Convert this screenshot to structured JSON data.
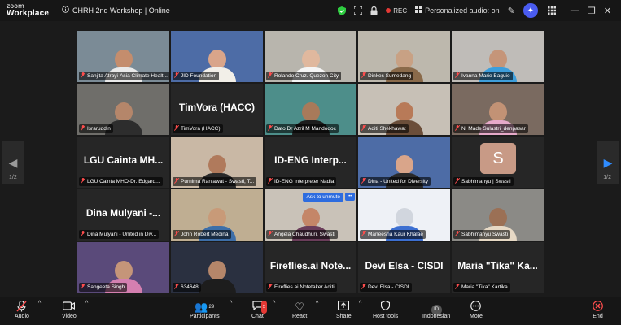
{
  "app": {
    "logo_top": "zoom",
    "logo_bottom": "Workplace",
    "meeting_title": "CHRH 2nd Workshop | Online"
  },
  "titlebar": {
    "rec_label": "REC",
    "audio_label": "Personalized audio: on"
  },
  "tiles": [
    {
      "label": "Sanjita Atrayi-Asia Climate Healt...",
      "bg": "#7b8b96",
      "skin": "#c48d6d",
      "shirt": "#e9e9e9"
    },
    {
      "label": "JID Foundation",
      "bg": "#4d6ca6",
      "skin": "#d9a58a",
      "shirt": "#f2efe8"
    },
    {
      "label": "Rolando Cruz. Quezon City",
      "bg": "#b8b5ad",
      "skin": "#e0b89e",
      "shirt": "#f5f5f5"
    },
    {
      "label": "Dinkes Sumedang",
      "bg": "#bdb8ad",
      "skin": "#c8a184",
      "shirt": "#8a6a4a"
    },
    {
      "label": "Ivanna Marie Baguio",
      "bg": "#bfbcb8",
      "skin": "#c59579",
      "shirt": "#3d9edb"
    },
    {
      "label": "Israruddin",
      "bg": "#6f6e6a",
      "skin": "#b5866a",
      "shirt": "#2d2d2d"
    },
    {
      "label": "TimVora (HACC)",
      "big": "TimVora (HACC)"
    },
    {
      "label": "Dato Dr Azril M Mandodoc",
      "bg": "#4d8e8a",
      "skin": "#a87a5a",
      "shirt": "#1d1d1d"
    },
    {
      "label": "Aditi Shekhawat",
      "bg": "#c7c0b6",
      "skin": "#b87a58",
      "shirt": "#6b4e3a"
    },
    {
      "label": "N. Made Sulastri_denpasar",
      "bg": "#7a6a60",
      "skin": "#c29275",
      "shirt": "#e6a9c9"
    },
    {
      "label": "LGU Cainta MHO-Dr. Edgard...",
      "big": "LGU Cainta MH..."
    },
    {
      "label": "Purnima Raniawat - Swasti, T...",
      "bg": "#c9b8a5",
      "skin": "#b07a5c",
      "shirt": "#2a2a2a"
    },
    {
      "label": "ID-ENG Interpreter Nadia",
      "big": "ID-ENG  Interp..."
    },
    {
      "label": "Dina - United for Diversity",
      "bg": "#4d6ca6",
      "skin": "#d9a58a",
      "shirt": "#2a2a2a"
    },
    {
      "label": "Sabhimanyu | Swasti",
      "avatar": "S"
    },
    {
      "label": "Dina Mulyani - United in Div...",
      "big": "Dina Mulyani  -..."
    },
    {
      "label": "John Robert Medina",
      "bg": "#bfae92",
      "skin": "#c89a78",
      "shirt": "#3d6ea8"
    },
    {
      "label": "Angela Chaudhuri, Swasti",
      "bg": "#c9c2b8",
      "skin": "#c48668",
      "shirt": "#6a3d5a",
      "unmute": "Ask to unmute"
    },
    {
      "label": "Maneesha Kaur Khalae",
      "bg": "#eef1f6",
      "skin": "#d1d6de",
      "shirt": "#3c6fd1"
    },
    {
      "label": "Sabhimanyu Swasti",
      "bg": "#8b8a86",
      "skin": "#9b7055",
      "shirt": "#e7d9c5"
    },
    {
      "label": "Sangeeta Singh",
      "bg": "#5a4a7a",
      "skin": "#c59579",
      "shirt": "#d47fb0"
    },
    {
      "label": "634648",
      "bg": "#2a3040",
      "skin": "#b5866a",
      "shirt": "#1d1d1d"
    },
    {
      "label": "Fireflies.ai Notetaker Aditi",
      "big": "Fireflies.ai  Note..."
    },
    {
      "label": "Devi Elsa - CISDI",
      "big": "Devi Elsa - CISDI"
    },
    {
      "label": "Maria \"Tika\" Kartika",
      "big": "Maria  \"Tika\"  Ka..."
    }
  ],
  "pager": {
    "left": "1/2",
    "right": "1/2"
  },
  "toolbar": {
    "audio": "Audio",
    "video": "Video",
    "participants": "Participants",
    "participants_count": "29",
    "chat": "Chat",
    "chat_badge": "5",
    "react": "React",
    "share": "Share",
    "host_tools": "Host tools",
    "language": "Indonesian",
    "language_code": "ID",
    "more": "More",
    "end": "End"
  }
}
